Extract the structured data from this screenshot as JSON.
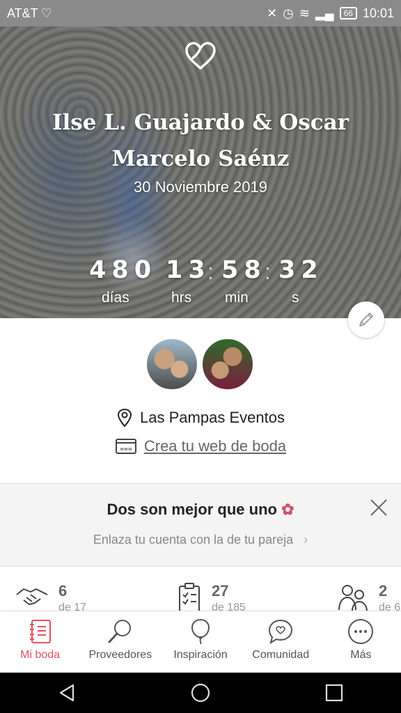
{
  "status_bar": {
    "carrier": "AT&T",
    "battery": "66",
    "time": "10:01"
  },
  "hero": {
    "couple_name": "Ilse L. Guajardo & Oscar Marcelo Saénz",
    "date": "30 Noviembre 2019",
    "countdown": {
      "days": "480",
      "days_label": "días",
      "hours": "13",
      "hours_label": "hrs",
      "minutes": "58",
      "minutes_label": "min",
      "seconds": "32",
      "seconds_label": "s"
    }
  },
  "venue": {
    "name": "Las Pampas Eventos"
  },
  "web_link": {
    "label": "Crea tu web de boda"
  },
  "promo": {
    "title": "Dos son mejor que uno",
    "subtitle": "Enlaza tu cuenta con la de tu pareja"
  },
  "stats": [
    {
      "value": "6",
      "sub": "de 17",
      "icon": "handshake-icon"
    },
    {
      "value": "27",
      "sub": "de 185",
      "icon": "checklist-icon"
    },
    {
      "value": "2",
      "sub": "de 6",
      "icon": "guests-icon"
    }
  ],
  "tabs": [
    {
      "label": "Mi boda",
      "icon": "notebook-icon",
      "active": true
    },
    {
      "label": "Proveedores",
      "icon": "search-icon",
      "active": false
    },
    {
      "label": "Inspiración",
      "icon": "balloon-icon",
      "active": false
    },
    {
      "label": "Comunidad",
      "icon": "chat-heart-icon",
      "active": false
    },
    {
      "label": "Más",
      "icon": "more-icon",
      "active": false
    }
  ],
  "colors": {
    "accent": "#e05260",
    "promo_bg": "#f4f4f4",
    "status_bar": "#8a8a8a"
  }
}
